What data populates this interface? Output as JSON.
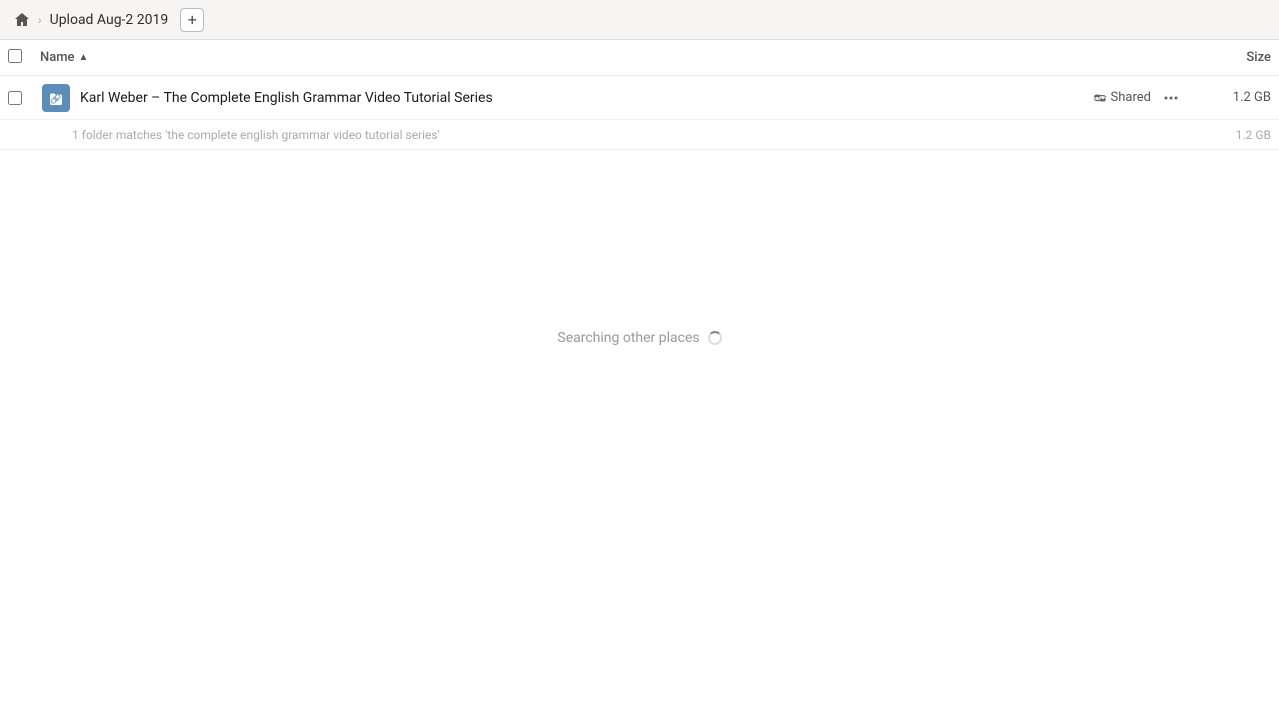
{
  "header": {
    "home_icon": "home",
    "breadcrumb": [
      {
        "label": "Upload Aug-2 2019"
      }
    ],
    "new_tab_label": "+"
  },
  "columns": {
    "name_label": "Name",
    "size_label": "Size",
    "sort_direction": "asc"
  },
  "file_row": {
    "name": "Karl Weber – The Complete English Grammar Video Tutorial Series",
    "shared_label": "Shared",
    "size": "1.2 GB",
    "more_icon": "•••"
  },
  "match_info": {
    "text": "1 folder matches 'the complete english grammar video tutorial series'",
    "size": "1.2 GB"
  },
  "searching": {
    "text": "Searching other places"
  }
}
